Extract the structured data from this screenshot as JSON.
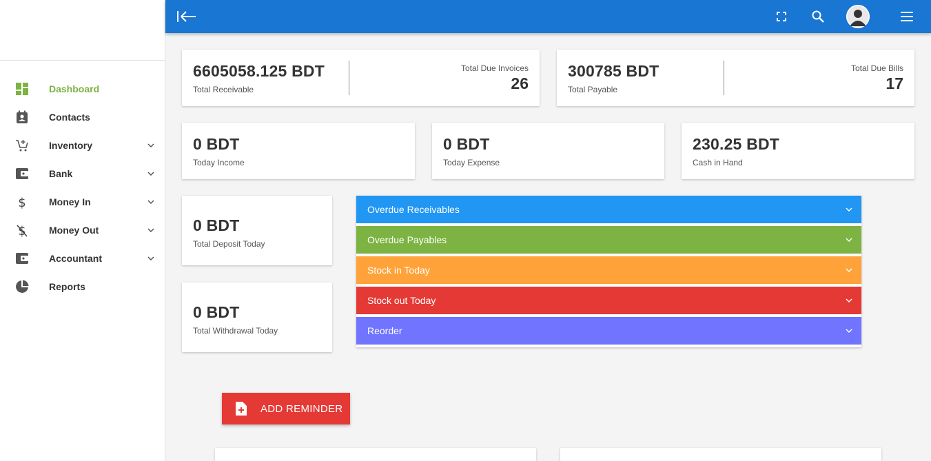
{
  "sidebar": {
    "items": [
      {
        "label": "Dashboard",
        "icon": "dashboard-icon",
        "active": true,
        "expandable": false
      },
      {
        "label": "Contacts",
        "icon": "contacts-icon",
        "active": false,
        "expandable": false
      },
      {
        "label": "Inventory",
        "icon": "cart-add-icon",
        "active": false,
        "expandable": true
      },
      {
        "label": "Bank",
        "icon": "wallet-icon",
        "active": false,
        "expandable": true
      },
      {
        "label": "Money In",
        "icon": "dollar-icon",
        "active": false,
        "expandable": true
      },
      {
        "label": "Money Out",
        "icon": "dollar-off-icon",
        "active": false,
        "expandable": true
      },
      {
        "label": "Accountant",
        "icon": "wallet-icon",
        "active": false,
        "expandable": true
      },
      {
        "label": "Reports",
        "icon": "pie-chart-icon",
        "active": false,
        "expandable": false
      }
    ]
  },
  "topbar": {
    "icons": [
      "collapse-sidebar-icon",
      "fullscreen-icon",
      "search-icon",
      "avatar",
      "menu-icon"
    ]
  },
  "summary": {
    "receivable": {
      "amount": "6605058.125 BDT",
      "caption": "Total Receivable",
      "count_label": "Total Due Invoices",
      "count": "26"
    },
    "payable": {
      "amount": "300785 BDT",
      "caption": "Total Payable",
      "count_label": "Total Due Bills",
      "count": "17"
    }
  },
  "today": {
    "income": {
      "amount": "0 BDT",
      "caption": "Today Income"
    },
    "expense": {
      "amount": "0 BDT",
      "caption": "Today Expense"
    },
    "cash": {
      "amount": "230.25 BDT",
      "caption": "Cash in Hand"
    }
  },
  "bank": {
    "deposit": {
      "amount": "0 BDT",
      "caption": "Total Deposit Today"
    },
    "withdrawal": {
      "amount": "0 BDT",
      "caption": "Total Withdrawal Today"
    }
  },
  "accordion": {
    "items": [
      {
        "label": "Overdue Receivables",
        "color": "#2196f3"
      },
      {
        "label": "Overdue Payables",
        "color": "#7cb342"
      },
      {
        "label": "Stock in Today",
        "color": "#ffa23a"
      },
      {
        "label": "Stock out Today",
        "color": "#e53935"
      },
      {
        "label": "Reorder",
        "color": "#7074ff"
      }
    ]
  },
  "reminder": {
    "button_label": "ADD REMINDER"
  },
  "colors": {
    "primary": "#1976d2",
    "active_nav": "#7cb342",
    "danger": "#e53935"
  }
}
